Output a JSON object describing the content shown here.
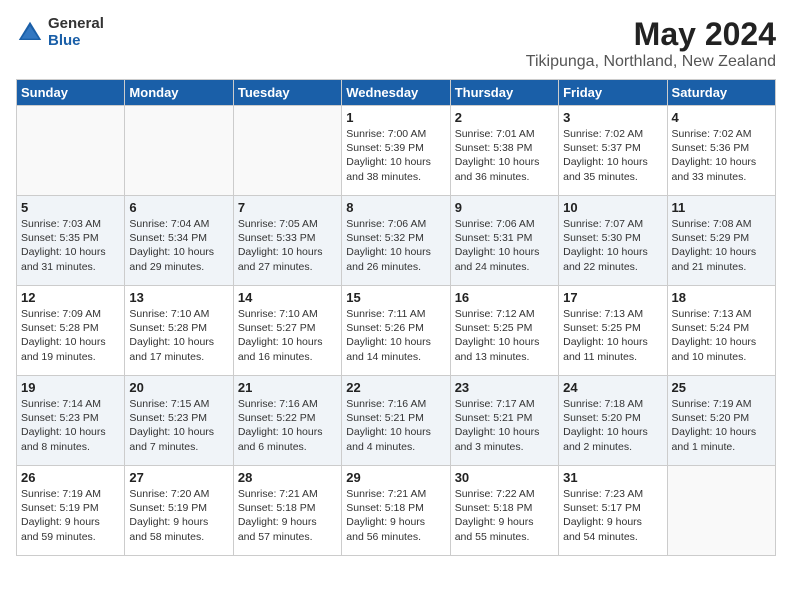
{
  "logo": {
    "general": "General",
    "blue": "Blue"
  },
  "title": {
    "month_year": "May 2024",
    "location": "Tikipunga, Northland, New Zealand"
  },
  "days_of_week": [
    "Sunday",
    "Monday",
    "Tuesday",
    "Wednesday",
    "Thursday",
    "Friday",
    "Saturday"
  ],
  "weeks": [
    [
      {
        "day": "",
        "detail": ""
      },
      {
        "day": "",
        "detail": ""
      },
      {
        "day": "",
        "detail": ""
      },
      {
        "day": "1",
        "detail": "Sunrise: 7:00 AM\nSunset: 5:39 PM\nDaylight: 10 hours\nand 38 minutes."
      },
      {
        "day": "2",
        "detail": "Sunrise: 7:01 AM\nSunset: 5:38 PM\nDaylight: 10 hours\nand 36 minutes."
      },
      {
        "day": "3",
        "detail": "Sunrise: 7:02 AM\nSunset: 5:37 PM\nDaylight: 10 hours\nand 35 minutes."
      },
      {
        "day": "4",
        "detail": "Sunrise: 7:02 AM\nSunset: 5:36 PM\nDaylight: 10 hours\nand 33 minutes."
      }
    ],
    [
      {
        "day": "5",
        "detail": "Sunrise: 7:03 AM\nSunset: 5:35 PM\nDaylight: 10 hours\nand 31 minutes."
      },
      {
        "day": "6",
        "detail": "Sunrise: 7:04 AM\nSunset: 5:34 PM\nDaylight: 10 hours\nand 29 minutes."
      },
      {
        "day": "7",
        "detail": "Sunrise: 7:05 AM\nSunset: 5:33 PM\nDaylight: 10 hours\nand 27 minutes."
      },
      {
        "day": "8",
        "detail": "Sunrise: 7:06 AM\nSunset: 5:32 PM\nDaylight: 10 hours\nand 26 minutes."
      },
      {
        "day": "9",
        "detail": "Sunrise: 7:06 AM\nSunset: 5:31 PM\nDaylight: 10 hours\nand 24 minutes."
      },
      {
        "day": "10",
        "detail": "Sunrise: 7:07 AM\nSunset: 5:30 PM\nDaylight: 10 hours\nand 22 minutes."
      },
      {
        "day": "11",
        "detail": "Sunrise: 7:08 AM\nSunset: 5:29 PM\nDaylight: 10 hours\nand 21 minutes."
      }
    ],
    [
      {
        "day": "12",
        "detail": "Sunrise: 7:09 AM\nSunset: 5:28 PM\nDaylight: 10 hours\nand 19 minutes."
      },
      {
        "day": "13",
        "detail": "Sunrise: 7:10 AM\nSunset: 5:28 PM\nDaylight: 10 hours\nand 17 minutes."
      },
      {
        "day": "14",
        "detail": "Sunrise: 7:10 AM\nSunset: 5:27 PM\nDaylight: 10 hours\nand 16 minutes."
      },
      {
        "day": "15",
        "detail": "Sunrise: 7:11 AM\nSunset: 5:26 PM\nDaylight: 10 hours\nand 14 minutes."
      },
      {
        "day": "16",
        "detail": "Sunrise: 7:12 AM\nSunset: 5:25 PM\nDaylight: 10 hours\nand 13 minutes."
      },
      {
        "day": "17",
        "detail": "Sunrise: 7:13 AM\nSunset: 5:25 PM\nDaylight: 10 hours\nand 11 minutes."
      },
      {
        "day": "18",
        "detail": "Sunrise: 7:13 AM\nSunset: 5:24 PM\nDaylight: 10 hours\nand 10 minutes."
      }
    ],
    [
      {
        "day": "19",
        "detail": "Sunrise: 7:14 AM\nSunset: 5:23 PM\nDaylight: 10 hours\nand 8 minutes."
      },
      {
        "day": "20",
        "detail": "Sunrise: 7:15 AM\nSunset: 5:23 PM\nDaylight: 10 hours\nand 7 minutes."
      },
      {
        "day": "21",
        "detail": "Sunrise: 7:16 AM\nSunset: 5:22 PM\nDaylight: 10 hours\nand 6 minutes."
      },
      {
        "day": "22",
        "detail": "Sunrise: 7:16 AM\nSunset: 5:21 PM\nDaylight: 10 hours\nand 4 minutes."
      },
      {
        "day": "23",
        "detail": "Sunrise: 7:17 AM\nSunset: 5:21 PM\nDaylight: 10 hours\nand 3 minutes."
      },
      {
        "day": "24",
        "detail": "Sunrise: 7:18 AM\nSunset: 5:20 PM\nDaylight: 10 hours\nand 2 minutes."
      },
      {
        "day": "25",
        "detail": "Sunrise: 7:19 AM\nSunset: 5:20 PM\nDaylight: 10 hours\nand 1 minute."
      }
    ],
    [
      {
        "day": "26",
        "detail": "Sunrise: 7:19 AM\nSunset: 5:19 PM\nDaylight: 9 hours\nand 59 minutes."
      },
      {
        "day": "27",
        "detail": "Sunrise: 7:20 AM\nSunset: 5:19 PM\nDaylight: 9 hours\nand 58 minutes."
      },
      {
        "day": "28",
        "detail": "Sunrise: 7:21 AM\nSunset: 5:18 PM\nDaylight: 9 hours\nand 57 minutes."
      },
      {
        "day": "29",
        "detail": "Sunrise: 7:21 AM\nSunset: 5:18 PM\nDaylight: 9 hours\nand 56 minutes."
      },
      {
        "day": "30",
        "detail": "Sunrise: 7:22 AM\nSunset: 5:18 PM\nDaylight: 9 hours\nand 55 minutes."
      },
      {
        "day": "31",
        "detail": "Sunrise: 7:23 AM\nSunset: 5:17 PM\nDaylight: 9 hours\nand 54 minutes."
      },
      {
        "day": "",
        "detail": ""
      }
    ]
  ]
}
